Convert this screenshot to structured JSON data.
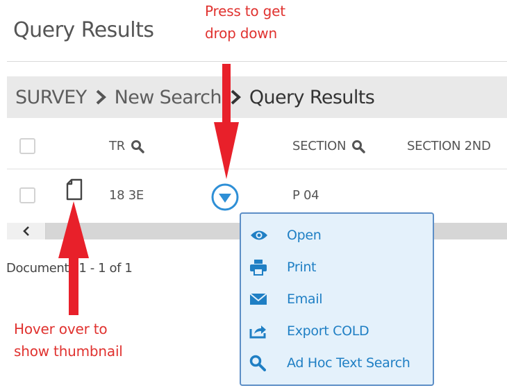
{
  "page": {
    "title": "Query Results"
  },
  "breadcrumb": {
    "items": [
      "SURVEY",
      "New Search",
      "Query Results"
    ]
  },
  "table": {
    "columns": [
      {
        "label": "TR",
        "searchable": true
      },
      {
        "label": "SECTION",
        "searchable": true
      },
      {
        "label": "SECTION 2ND",
        "searchable": false
      }
    ],
    "rows": [
      {
        "tr": "18 3E",
        "section": "P 04"
      }
    ]
  },
  "pagination": {
    "label": "Documents 1 - 1 of 1"
  },
  "context_menu": {
    "items": [
      {
        "label": "Open",
        "icon": "eye-icon"
      },
      {
        "label": "Print",
        "icon": "printer-icon"
      },
      {
        "label": "Email",
        "icon": "envelope-icon"
      },
      {
        "label": "Export COLD",
        "icon": "export-icon"
      },
      {
        "label": "Ad Hoc Text Search",
        "icon": "search-icon"
      }
    ]
  },
  "annotations": {
    "dropdown_hint": [
      "Press to get",
      "drop down"
    ],
    "thumbnail_hint": [
      "Hover over to",
      "show thumbnail"
    ]
  },
  "colors": {
    "annotation_red": "#e0322f",
    "arrow_red": "#e8202a",
    "menu_text_blue": "#1f7fc4",
    "menu_bg": "#e4f1fb",
    "menu_border": "#5c8ec6"
  }
}
